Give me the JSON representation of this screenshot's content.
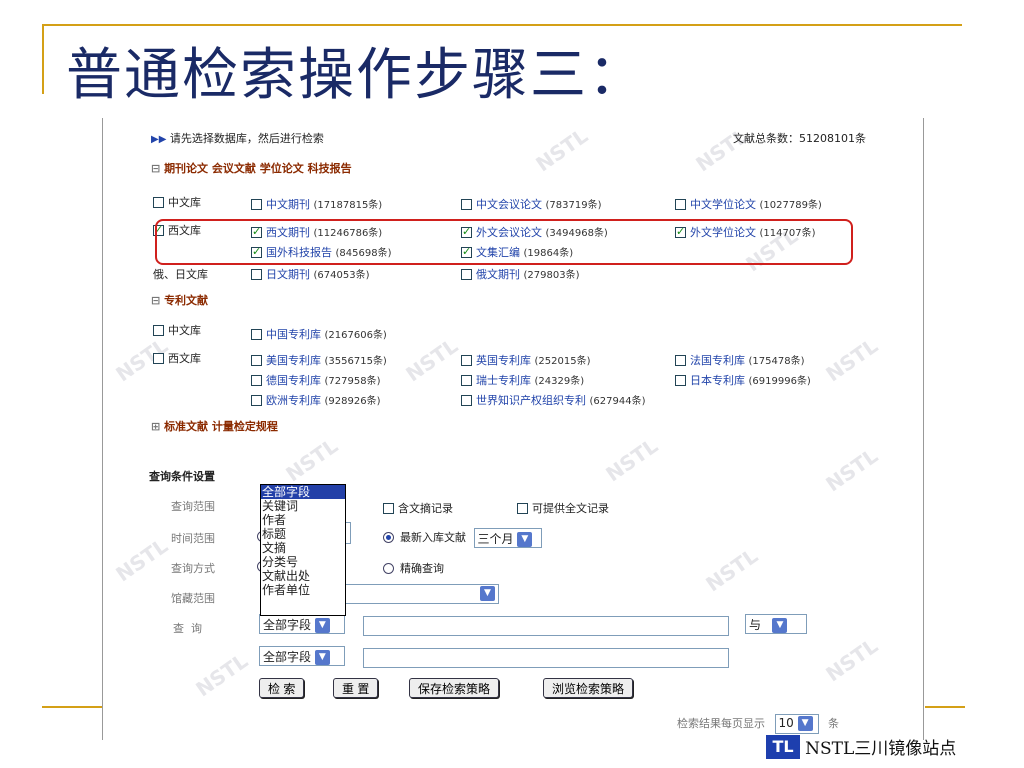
{
  "slide": {
    "title": "普通检索操作步骤三：",
    "footer_text": "NSTL三川镜像站点",
    "logo_text": "TL",
    "watermark": "NSTL"
  },
  "header": {
    "instruction": "请先选择数据库，然后进行检索",
    "total": "文献总条数：51208101条"
  },
  "sections": {
    "journals": {
      "tree": "⊟",
      "tabs": [
        "期刊论文",
        "会议文献",
        "学位论文",
        "科技报告"
      ]
    },
    "patents": {
      "tree": "⊟",
      "label": "专利文献"
    },
    "standards": {
      "tree": "⊞",
      "tabs": [
        "标准文献",
        "计量检定规程"
      ]
    }
  },
  "rows": {
    "cn_lib": {
      "label": "中文库",
      "items": [
        {
          "name": "中文期刊",
          "count": "(17187815条)",
          "checked": false
        },
        {
          "name": "中文会议论文",
          "count": "(783719条)",
          "checked": false
        },
        {
          "name": "中文学位论文",
          "count": "(1027789条)",
          "checked": false
        }
      ]
    },
    "west_lib": {
      "label": "西文库",
      "items": [
        {
          "name": "西文期刊",
          "count": "(11246786条)",
          "checked": true
        },
        {
          "name": "外文会议论文",
          "count": "(3494968条)",
          "checked": true
        },
        {
          "name": "外文学位论文",
          "count": "(114707条)",
          "checked": true
        },
        {
          "name": "国外科技报告",
          "count": "(845698条)",
          "checked": true
        },
        {
          "name": "文集汇编",
          "count": "(19864条)",
          "checked": true
        }
      ]
    },
    "ru_jp": {
      "label": "俄、日文库",
      "items": [
        {
          "name": "日文期刊",
          "count": "(674053条)",
          "checked": false
        },
        {
          "name": "俄文期刊",
          "count": "(279803条)",
          "checked": false
        }
      ]
    },
    "pat_cn": {
      "label": "中文库",
      "items": [
        {
          "name": "中国专利库",
          "count": "(2167606条)",
          "checked": false
        }
      ]
    },
    "pat_west": {
      "label": "西文库",
      "items": [
        {
          "name": "美国专利库",
          "count": "(3556715条)",
          "checked": false
        },
        {
          "name": "英国专利库",
          "count": "(252015条)",
          "checked": false
        },
        {
          "name": "法国专利库",
          "count": "(175478条)",
          "checked": false
        },
        {
          "name": "德国专利库",
          "count": "(727958条)",
          "checked": false
        },
        {
          "name": "瑞士专利库",
          "count": "(24329条)",
          "checked": false
        },
        {
          "name": "日本专利库",
          "count": "(6919996条)",
          "checked": false
        },
        {
          "name": "欧洲专利库",
          "count": "(928926条)",
          "checked": false
        },
        {
          "name": "世界知识产权组织专利",
          "count": "(627944条)",
          "checked": false
        }
      ]
    }
  },
  "query": {
    "heading": "查询条件设置",
    "labels": [
      "查询范围",
      "时间范围",
      "查询方式",
      "馆藏范围",
      "查  询"
    ],
    "options_range": [
      "含文摘记录",
      "可提供全文记录"
    ],
    "recent": "最新入库文献",
    "recent_select": "三个月",
    "exact": "精确查询",
    "field_select": "全部字段",
    "logic_select": "与",
    "dropdown_items": [
      "全部字段",
      "关键词",
      "作者",
      "标题",
      "文摘",
      "分类号",
      "文献出处",
      "作者单位"
    ],
    "buttons": [
      "检 索",
      "重 置",
      "保存检索策略",
      "浏览检索策略"
    ],
    "per_page_label": "检索结果每页显示",
    "per_page_value": "10",
    "per_page_unit": "条"
  }
}
